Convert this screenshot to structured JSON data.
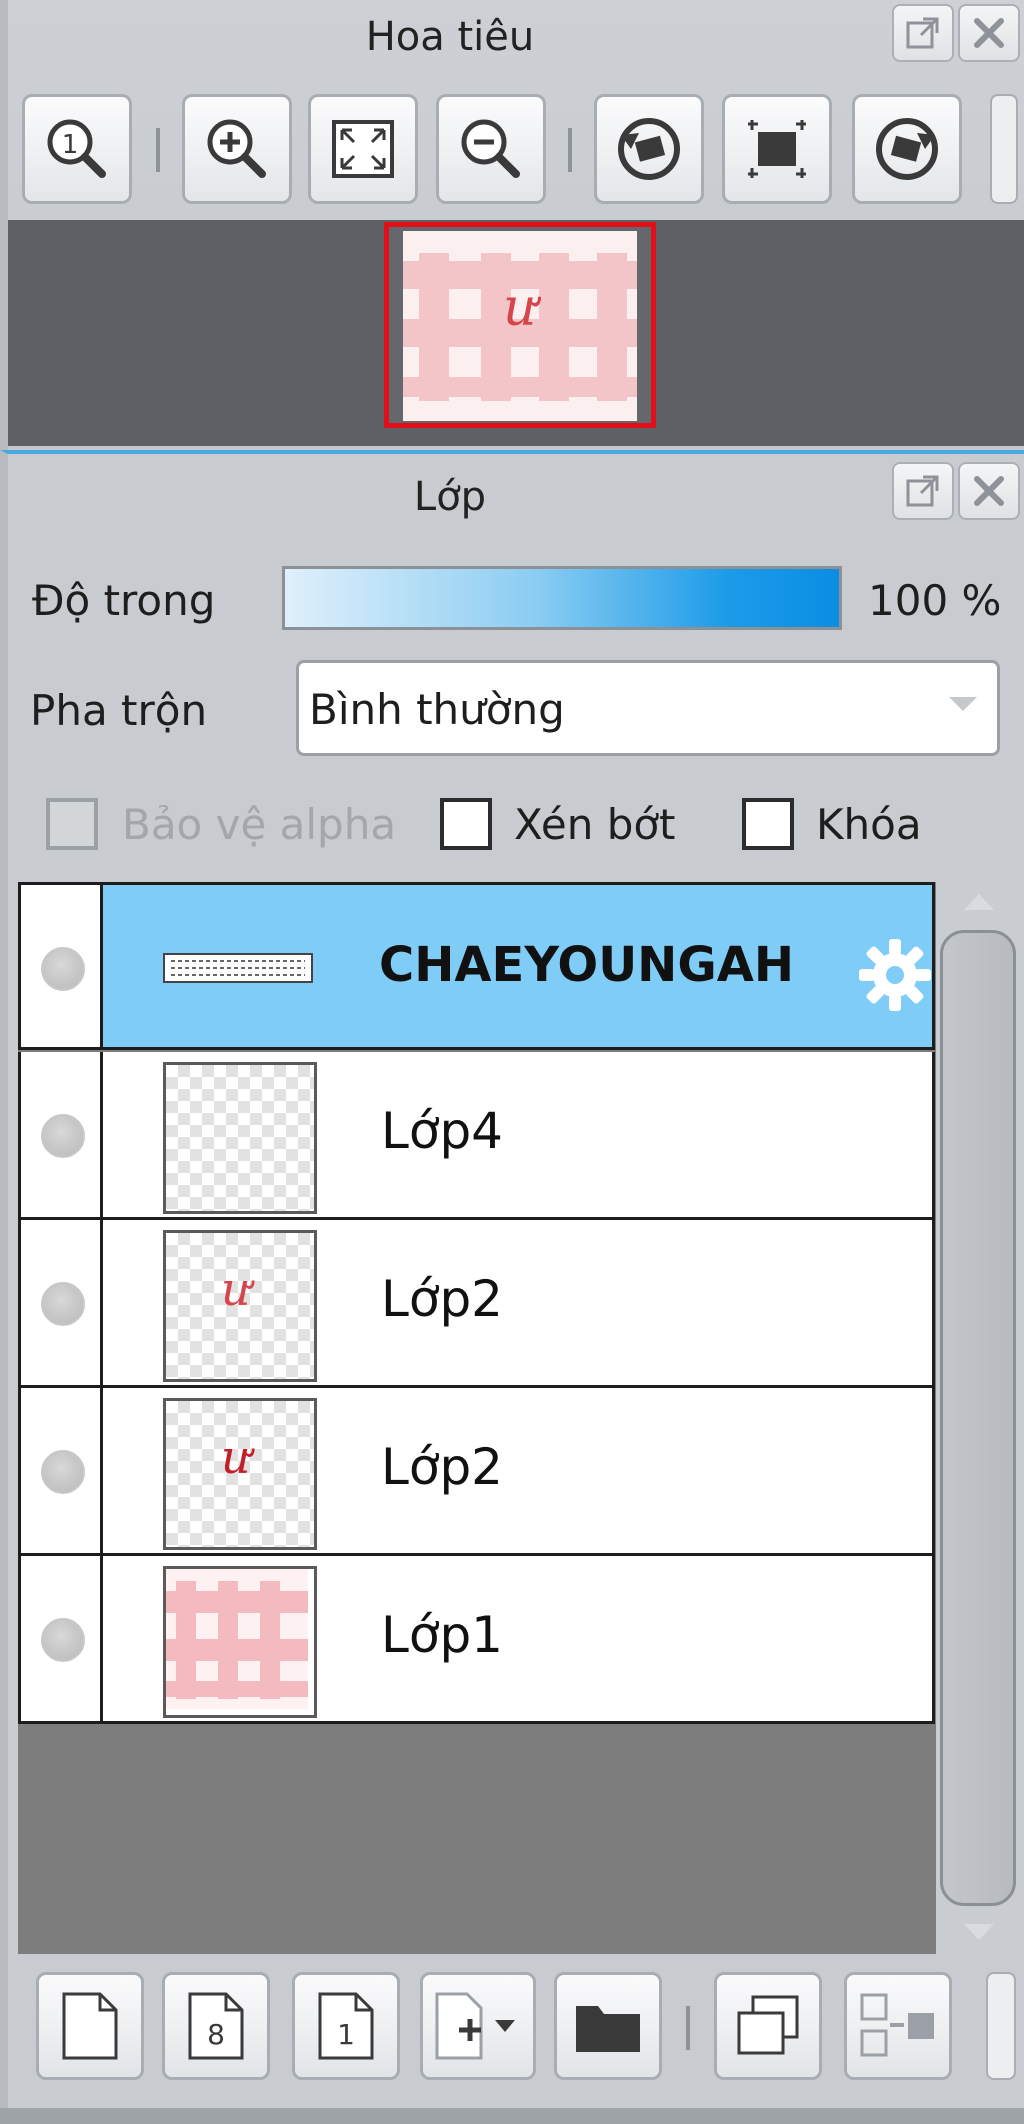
{
  "navigator": {
    "title": "Hoa tiêu",
    "toolbar": [
      "zoom-actual-icon",
      "zoom-in-icon",
      "fit-screen-icon",
      "zoom-out-icon",
      "rotate-left-icon",
      "fit-frame-icon",
      "rotate-right-icon"
    ]
  },
  "layer_panel": {
    "title": "Lớp",
    "opacity": {
      "label": "Độ trong",
      "value_text": "100 %",
      "value": 100
    },
    "blend": {
      "label": "Pha trộn",
      "selected": "Bình thường"
    },
    "options": {
      "protect_alpha": {
        "label": "Bảo vệ alpha",
        "checked": false,
        "enabled": false
      },
      "clip": {
        "label": "Xén bớt",
        "checked": false
      },
      "lock": {
        "label": "Khóa",
        "checked": false
      }
    },
    "layers": [
      {
        "name": "CHAEYOUNGAH",
        "selected": true,
        "type": "text-layer"
      },
      {
        "name": "Lớp4",
        "selected": false,
        "type": "empty"
      },
      {
        "name": "Lớp2",
        "selected": false,
        "type": "letter"
      },
      {
        "name": "Lớp2",
        "selected": false,
        "type": "letter"
      },
      {
        "name": "Lớp1",
        "selected": false,
        "type": "pattern"
      }
    ],
    "bottom_toolbar": [
      "new-layer-icon",
      "new-8bit-layer-icon",
      "new-1bit-layer-icon",
      "add-layer-menu-icon",
      "new-folder-icon",
      "duplicate-layer-icon",
      "merge-layer-icon"
    ]
  },
  "colors": {
    "selected_row": "#7fcdf6",
    "accent_line": "#49a8e0",
    "nav_frame": "#e20f18"
  }
}
